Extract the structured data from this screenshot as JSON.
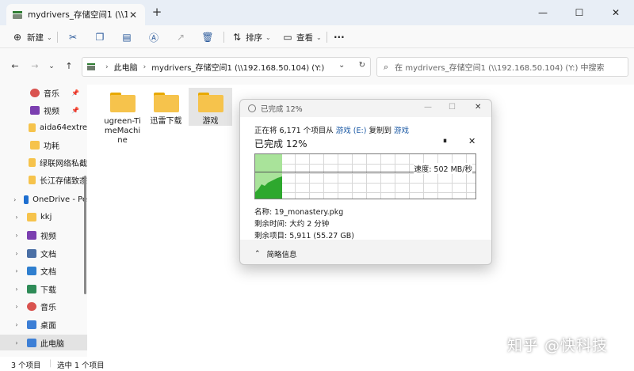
{
  "tab": {
    "title": "mydrivers_存储空间1 (\\\\192.16",
    "close": "✕",
    "new_tab": "+"
  },
  "window_controls": {
    "minimize": "—",
    "maximize": "☐",
    "close": "✕"
  },
  "toolbar": {
    "new_label": "新建",
    "sort_label": "排序",
    "view_label": "查看",
    "more_label": "···"
  },
  "address": {
    "root": "此电脑",
    "location": "mydrivers_存储空间1 (\\\\192.168.50.104) (Y:)",
    "search_placeholder": "在 mydrivers_存储空间1 (\\\\192.168.50.104) (Y:) 中搜索"
  },
  "sidebar": {
    "items": [
      {
        "label": "音乐",
        "icon": "music-icon",
        "color": "#d9534f",
        "pinned": true
      },
      {
        "label": "视频",
        "icon": "video-icon",
        "color": "#7b3fb0",
        "pinned": true
      },
      {
        "label": "aida64extre",
        "icon": "folder-icon",
        "color": "#f6c34c"
      },
      {
        "label": "功耗",
        "icon": "folder-icon",
        "color": "#f6c34c"
      },
      {
        "label": "绿联网络私截",
        "icon": "folder-icon",
        "color": "#f6c34c"
      },
      {
        "label": "长江存储致态",
        "icon": "folder-icon",
        "color": "#f6c34c"
      },
      {
        "label": "OneDrive - Pe",
        "icon": "cloud-icon",
        "color": "#1e6fd0"
      },
      {
        "label": "kkj",
        "icon": "folder-icon",
        "color": "#f6c34c"
      },
      {
        "label": "视频",
        "icon": "video-icon",
        "color": "#7b3fb0"
      },
      {
        "label": "文档",
        "icon": "document-icon",
        "color": "#4a6fa5"
      },
      {
        "label": "文档",
        "icon": "image-icon",
        "color": "#2f7fcf"
      },
      {
        "label": "下载",
        "icon": "download-icon",
        "color": "#2e8b57"
      },
      {
        "label": "音乐",
        "icon": "music-icon",
        "color": "#d9534f"
      },
      {
        "label": "桌面",
        "icon": "desktop-icon",
        "color": "#3d7fd6"
      },
      {
        "label": "此电脑",
        "icon": "computer-icon",
        "color": "#3d7fd6"
      }
    ]
  },
  "files": [
    {
      "name": "ugreen-TimeMachine"
    },
    {
      "name": "迅雷下载"
    },
    {
      "name": "游戏"
    }
  ],
  "status": {
    "count": "3 个项目",
    "selected": "选中 1 个项目"
  },
  "dialog": {
    "title": "已完成 12%",
    "copy_prefix": "正在将 6,171 个项目从",
    "source": "游戏 (E:)",
    "copy_mid": "复制到",
    "dest": "游戏",
    "percent_label": "已完成 12%",
    "progress_fraction": 0.12,
    "pause_icon": "⏸",
    "speed": "速度: 502 MB/秒",
    "name_line": "名称: 19_monastery.pkg",
    "time_line": "剩余时间: 大约 2 分钟",
    "items_line": "剩余项目: 5,911 (55.27 GB)",
    "less_details": "简略信息",
    "graph_color": "#a9e39a",
    "graph_fill": "#2ea82e"
  },
  "watermark": "知乎 @快科技"
}
